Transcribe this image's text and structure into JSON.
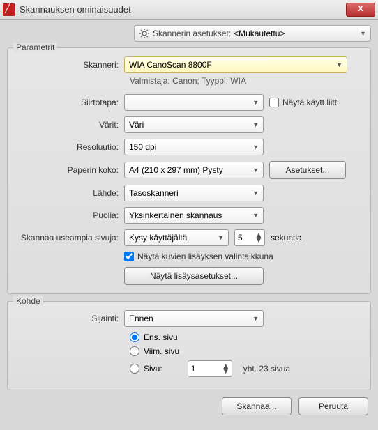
{
  "window": {
    "title": "Skannauksen ominaisuudet"
  },
  "scanner_settings": {
    "label": "Skannerin asetukset:",
    "value": "<Mukautettu>"
  },
  "group_params": {
    "legend": "Parametrit"
  },
  "group_target": {
    "legend": "Kohde"
  },
  "labels": {
    "scanner": "Skanneri:",
    "transfer": "Siirtotapa:",
    "colors": "Värit:",
    "resolution": "Resoluutio:",
    "paper_size": "Paperin koko:",
    "source": "Lähde:",
    "sides": "Puolia:",
    "scan_multiple": "Skannaa useampia sivuja:",
    "seconds": "sekuntia",
    "show_user_ui": "Näytä käytt.liitt.",
    "show_image_add_dialog": "Näytä kuvien lisäyksen valintaikkuna",
    "location": "Sijainti:"
  },
  "values": {
    "scanner": "WIA CanoScan 8800F",
    "manufacturer": "Valmistaja: Canon; Tyyppi: WIA",
    "transfer": "",
    "colors": "Väri",
    "resolution": "150 dpi",
    "paper_size": "A4 (210 x 297 mm) Pysty",
    "source": "Tasoskanneri",
    "sides": "Yksinkertainen skannaus",
    "scan_multiple": "Kysy käyttäjältä",
    "scan_delay": "5",
    "location": "Ennen",
    "page_spin": "1",
    "total_pages": "yht. 23 sivua"
  },
  "radios": {
    "first_page": "Ens. sivu",
    "last_page": "Viim. sivu",
    "page": "Sivu:"
  },
  "buttons": {
    "settings": "Asetukset...",
    "show_add_settings": "Näytä lisäysasetukset...",
    "scan": "Skannaa...",
    "cancel": "Peruuta"
  }
}
